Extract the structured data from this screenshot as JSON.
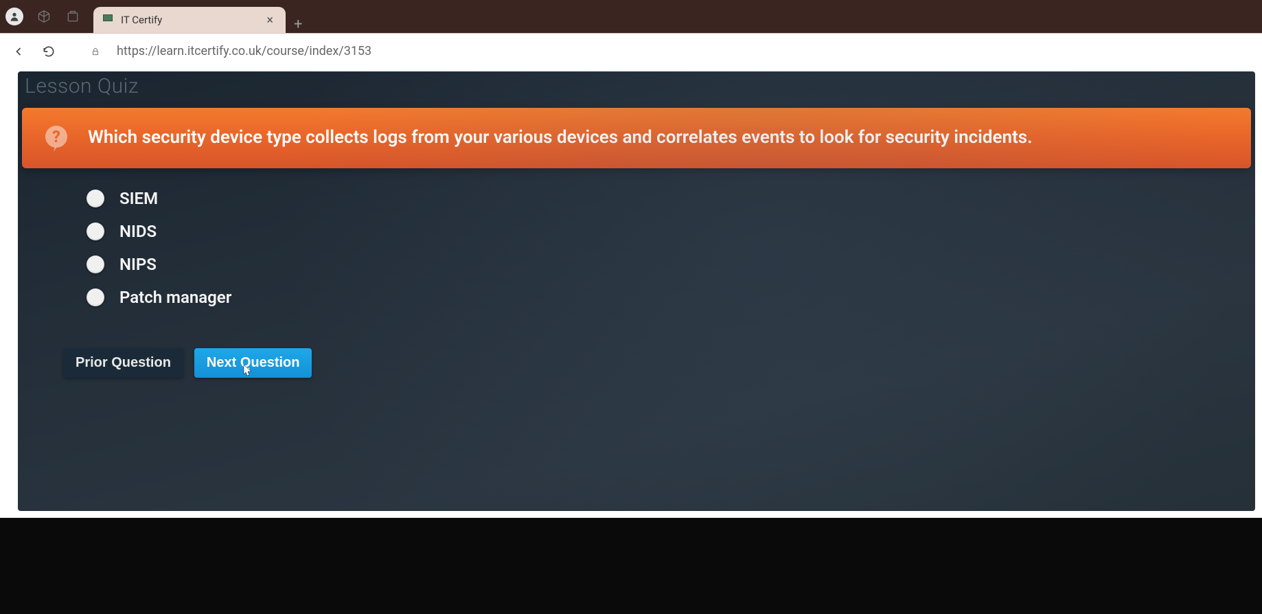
{
  "browser": {
    "tab_title": "IT Certify",
    "url": "https://learn.itcertify.co.uk/course/index/3153"
  },
  "quiz": {
    "page_title": "Lesson Quiz",
    "question": "Which security device type collects logs from your various devices and correlates events to look for security incidents.",
    "options": [
      {
        "label": "SIEM"
      },
      {
        "label": "NIDS"
      },
      {
        "label": "NIPS"
      },
      {
        "label": "Patch manager"
      }
    ],
    "buttons": {
      "prior": "Prior Question",
      "next": "Next Question"
    }
  }
}
